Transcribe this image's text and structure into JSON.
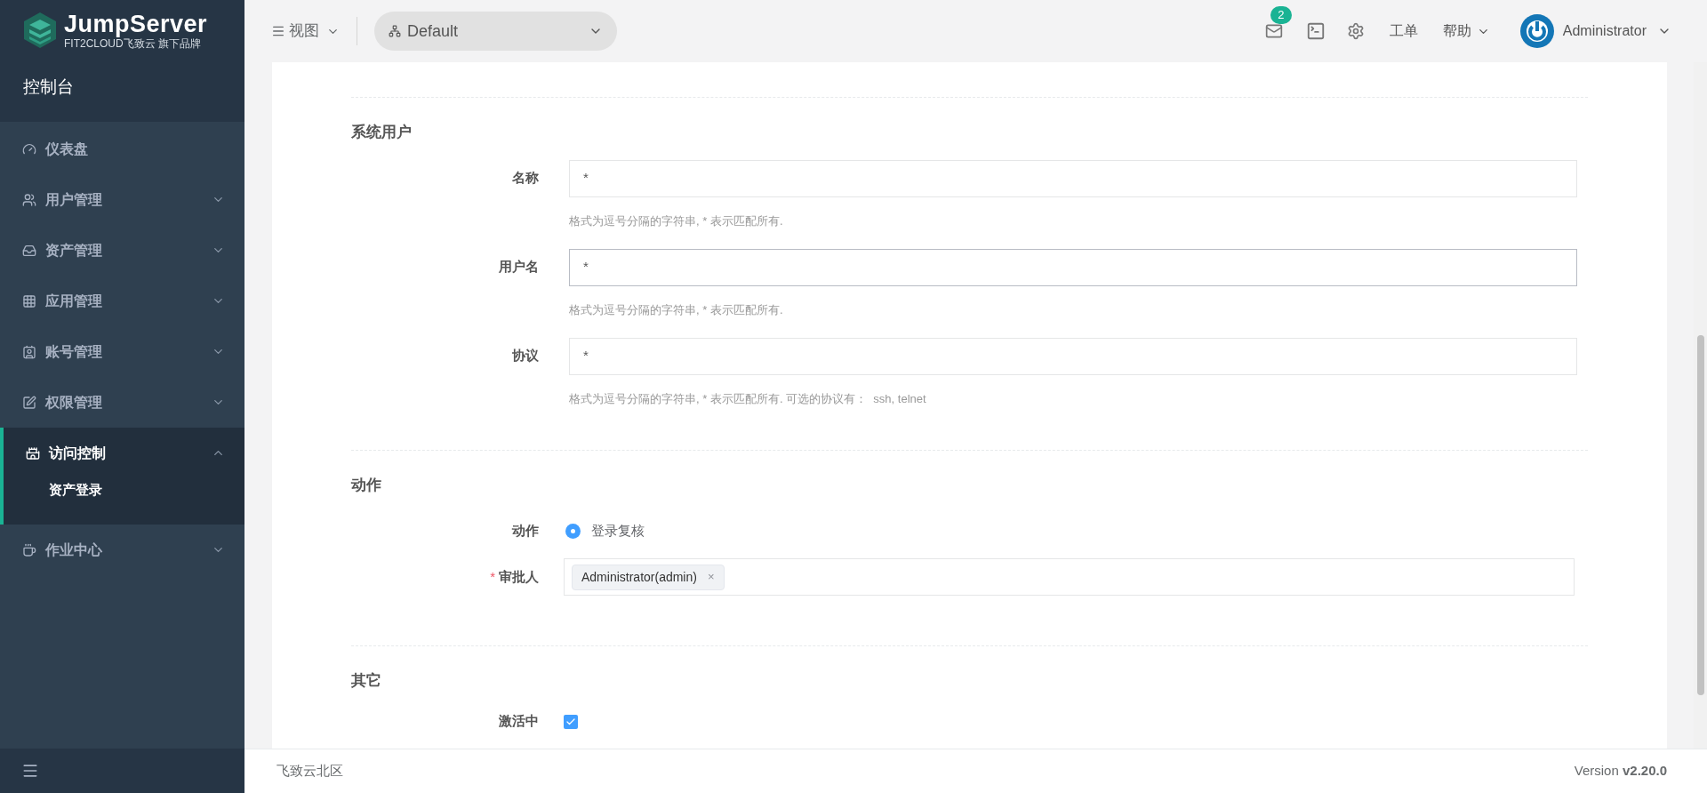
{
  "brand": {
    "name": "JumpServer",
    "tagline": "FIT2CLOUD飞致云 旗下品牌"
  },
  "sidebar": {
    "title": "控制台",
    "items": [
      {
        "kind": "link",
        "label": "仪表盘",
        "selected": false
      },
      {
        "kind": "group",
        "label": "用户管理",
        "expanded": false,
        "selected": false
      },
      {
        "kind": "group",
        "label": "资产管理",
        "expanded": false,
        "selected": false
      },
      {
        "kind": "group",
        "label": "应用管理",
        "expanded": false,
        "selected": false
      },
      {
        "kind": "group",
        "label": "账号管理",
        "expanded": false,
        "selected": false
      },
      {
        "kind": "group",
        "label": "权限管理",
        "expanded": false,
        "selected": false
      },
      {
        "kind": "group",
        "label": "访问控制",
        "expanded": true,
        "selected": true,
        "children": [
          {
            "label": "资产登录",
            "selected": true
          }
        ]
      },
      {
        "kind": "group",
        "label": "作业中心",
        "expanded": false,
        "selected": false
      }
    ]
  },
  "topbar": {
    "view_label": "视图",
    "org": "Default",
    "mail_badge": "2",
    "tickets": "工单",
    "help": "帮助",
    "user": "Administrator"
  },
  "sections": [
    {
      "title": "系统用户",
      "fields": [
        {
          "kind": "text",
          "label": "名称",
          "value": "*",
          "focused": false,
          "hint": "格式为逗号分隔的字符串, * 表示匹配所有."
        },
        {
          "kind": "text",
          "label": "用户名",
          "value": "*",
          "focused": true,
          "hint": "格式为逗号分隔的字符串, * 表示匹配所有."
        },
        {
          "kind": "text",
          "label": "协议",
          "value": "*",
          "focused": false,
          "hint": "格式为逗号分隔的字符串, * 表示匹配所有. 可选的协议有：  ssh, telnet"
        }
      ]
    },
    {
      "title": "动作",
      "fields": [
        {
          "kind": "radio",
          "label": "动作",
          "options": [
            {
              "label": "登录复核",
              "selected": true
            }
          ]
        },
        {
          "kind": "tags",
          "label": "审批人",
          "required_mark": "*",
          "tags": [
            "Administrator(admin)"
          ],
          "remove_glyph": "×"
        }
      ]
    },
    {
      "title": "其它",
      "fields": [
        {
          "kind": "checkbox",
          "label": "激活中",
          "checked": true
        }
      ]
    }
  ],
  "footer": {
    "left": "飞致云北区",
    "version": "Version **v2.20.0**"
  }
}
